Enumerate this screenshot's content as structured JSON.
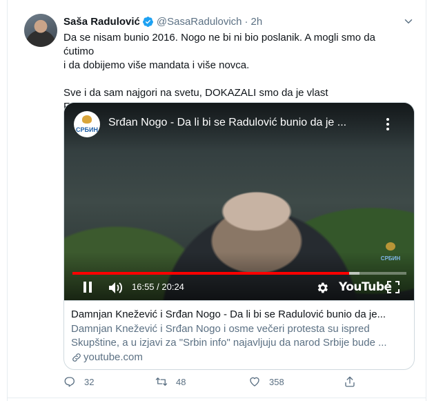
{
  "tweet": {
    "author_name": "Saša Radulović",
    "handle": "@SasaRadulovich",
    "separator": "·",
    "time": "2h",
    "text": "Da se nisam bunio 2016. Nogo ne bi ni bio poslanik. A mogli smo da ćutimo\ni da dobijemo više mandata i više novca.\n\nSve i da sam najgori na svetu, DOKAZALI smo da je vlast FALSIFIKOVALA\nizbore. Čemu ovo? Sujeta ili nešto gore?"
  },
  "video": {
    "channel_logo_text": "СРБИН",
    "title": "Srđan Nogo - Da li bi se Radulović bunio da je ...",
    "watermark_text": "СРБИН",
    "time_display": "16:55 / 20:24",
    "played_fraction": 0.829,
    "buffered_fraction": 0.86,
    "youtube_label": "YouTube"
  },
  "link_card": {
    "title": "Damnjan Knežević i Srđan Nogo - Da li bi se Radulović bunio da je...",
    "description": "Damnjan Knežević i Srđan Nogo i osme večeri protesta su ispred Skupštine, a u izjavi za \"Srbin info\" najavljuju da narod Srbije bude ...",
    "domain": "youtube.com"
  },
  "actions": {
    "reply_count": "32",
    "retweet_count": "48",
    "like_count": "358"
  },
  "colors": {
    "verified": "#1da1f2",
    "secondary_text": "#5b7083",
    "progress_played": "#ff0000"
  },
  "icons": [
    "verified-badge-icon",
    "chevron-down-icon",
    "more-vertical-icon",
    "pause-icon",
    "volume-icon",
    "settings-gear-icon",
    "fullscreen-icon",
    "link-icon",
    "reply-icon",
    "retweet-icon",
    "like-icon",
    "share-icon"
  ]
}
